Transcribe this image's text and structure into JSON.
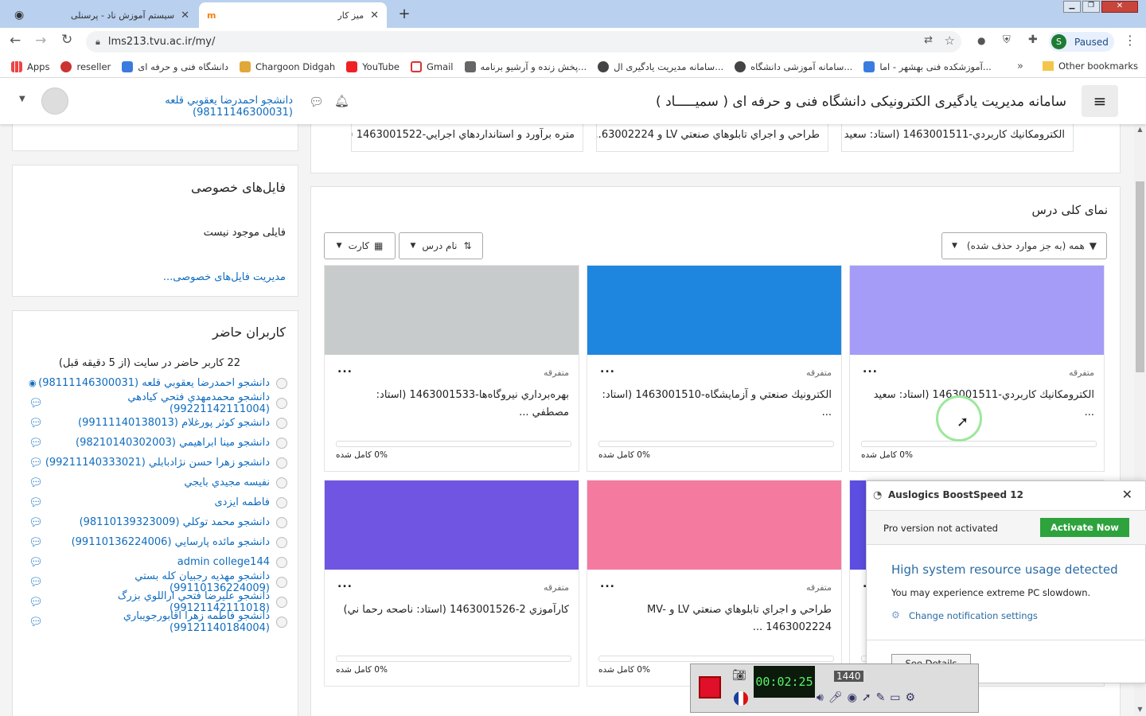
{
  "browser": {
    "tabs": [
      {
        "title": "سیستم آموزش ناد - پرسنلی"
      },
      {
        "title": "میز کار"
      }
    ],
    "url": "lms213.tvu.ac.ir/my/",
    "profile_initial": "S",
    "profile_status": "Paused",
    "bookmarks": [
      "Apps",
      "reseller",
      "دانشگاه فنی و حرفه ای",
      "Chargoon Didgah",
      "YouTube",
      "Gmail",
      "پخش زنده و آرشیو برنامه...",
      "سامانه مدیریت یادگیری ال...",
      "سامانه آموزشی دانشگاه...",
      "آموزشکده فنی بهشهر - اما..."
    ],
    "other_bookmarks": "Other bookmarks",
    "more": "»"
  },
  "site": {
    "title": "سامانه مدیریت یادگیری الکترونیکی دانشگاه فنی و حرفه ای ( سمیـــــاد )",
    "user": "دانشجو احمدرضا يعقوبي قلعه (98111146300031)"
  },
  "recent_courses": [
    "الكترومكانيك كاربردي-1463001511 (استاد: سعيد ...",
    "طراحي و اجراي تابلوهاي صنعتي LV و 63002224...",
    "متره برآورد و استانداردهاي اجرايي-1463001522 (..."
  ],
  "private_files": {
    "title": "فایل‌های خصوصی",
    "empty": "فایلی موجود نیست",
    "manage": "مدیریت فایل‌های خصوصی..."
  },
  "online_users": {
    "title": "کاربران حاضر",
    "summary": "22 کاربر حاضر در سایت (از 5 دقیقه قبل)",
    "users": [
      "دانشجو احمدرضا يعقوبي قلعه (98111146300031)",
      "دانشجو محمدمهدي فتحي كيادهي (99221142111004)",
      "دانشجو کوثر پورغلام (99111140138013)",
      "دانشجو مينا ابراهيمي (98210140302003)",
      "دانشجو زهرا حسن نژادبابلي (99211140333021)",
      "نفيسه مجيدي بايجي",
      "فاطمه ايزدی",
      "دانشجو محمد توكلي (98110139323009)",
      "دانشجو مائده پارسايي (99110136224006)",
      "admin college144",
      "دانشجو مهديه رجبيان كله بستي (99110136224009)",
      "دانشجو عليرضا فتحي اراللوي بزرگ (99121142111018)",
      "دانشجو فاطمه زهرا اقابورجويباري (99121140184004)"
    ]
  },
  "overview": {
    "title": "نمای کلی درس",
    "filter": "همه (به جز موارد حذف شده)",
    "sort": "نام درس",
    "view": "کارت",
    "category": "متفرقه",
    "progress_suffix": "0% کامل شده",
    "more": "...",
    "courses": [
      {
        "name": "الكترومكانيك كاربردي-1463001511 (استاد: سعيد ...",
        "color": "#a49cf7",
        "progress": 0
      },
      {
        "name": "الكترونيك صنعتي و آزمايشگاه-1463001510 (استاد: ...",
        "color": "#1f86e0",
        "progress": 0
      },
      {
        "name": "بهره‌برداري نيروگاه‌ها-1463001533 (استاد: مصطفي ...",
        "color": "#c7cbcc",
        "progress": 0
      },
      {
        "name": "",
        "color": "#5b4ee0",
        "progress": 0
      },
      {
        "name": "طراحي و اجراي تابلوهاي صنعتي LV و MV- 1463002224 ...",
        "color": "#f57aa0",
        "progress": 0
      },
      {
        "name": "كارآموزي 2-1463001526 (استاد: ناصحه رحما ني)",
        "color": "#6f55e2",
        "progress": 0
      }
    ]
  },
  "popup": {
    "app": "Auslogics BoostSpeed 12",
    "pro": "Pro version not activated",
    "activate": "Activate Now",
    "headline": "High system resource usage detected",
    "desc": "You may experience extreme PC slowdown.",
    "settings": "Change notification settings",
    "details": "See Details"
  },
  "recorder": {
    "time": "00:02:25",
    "res": "1440"
  }
}
